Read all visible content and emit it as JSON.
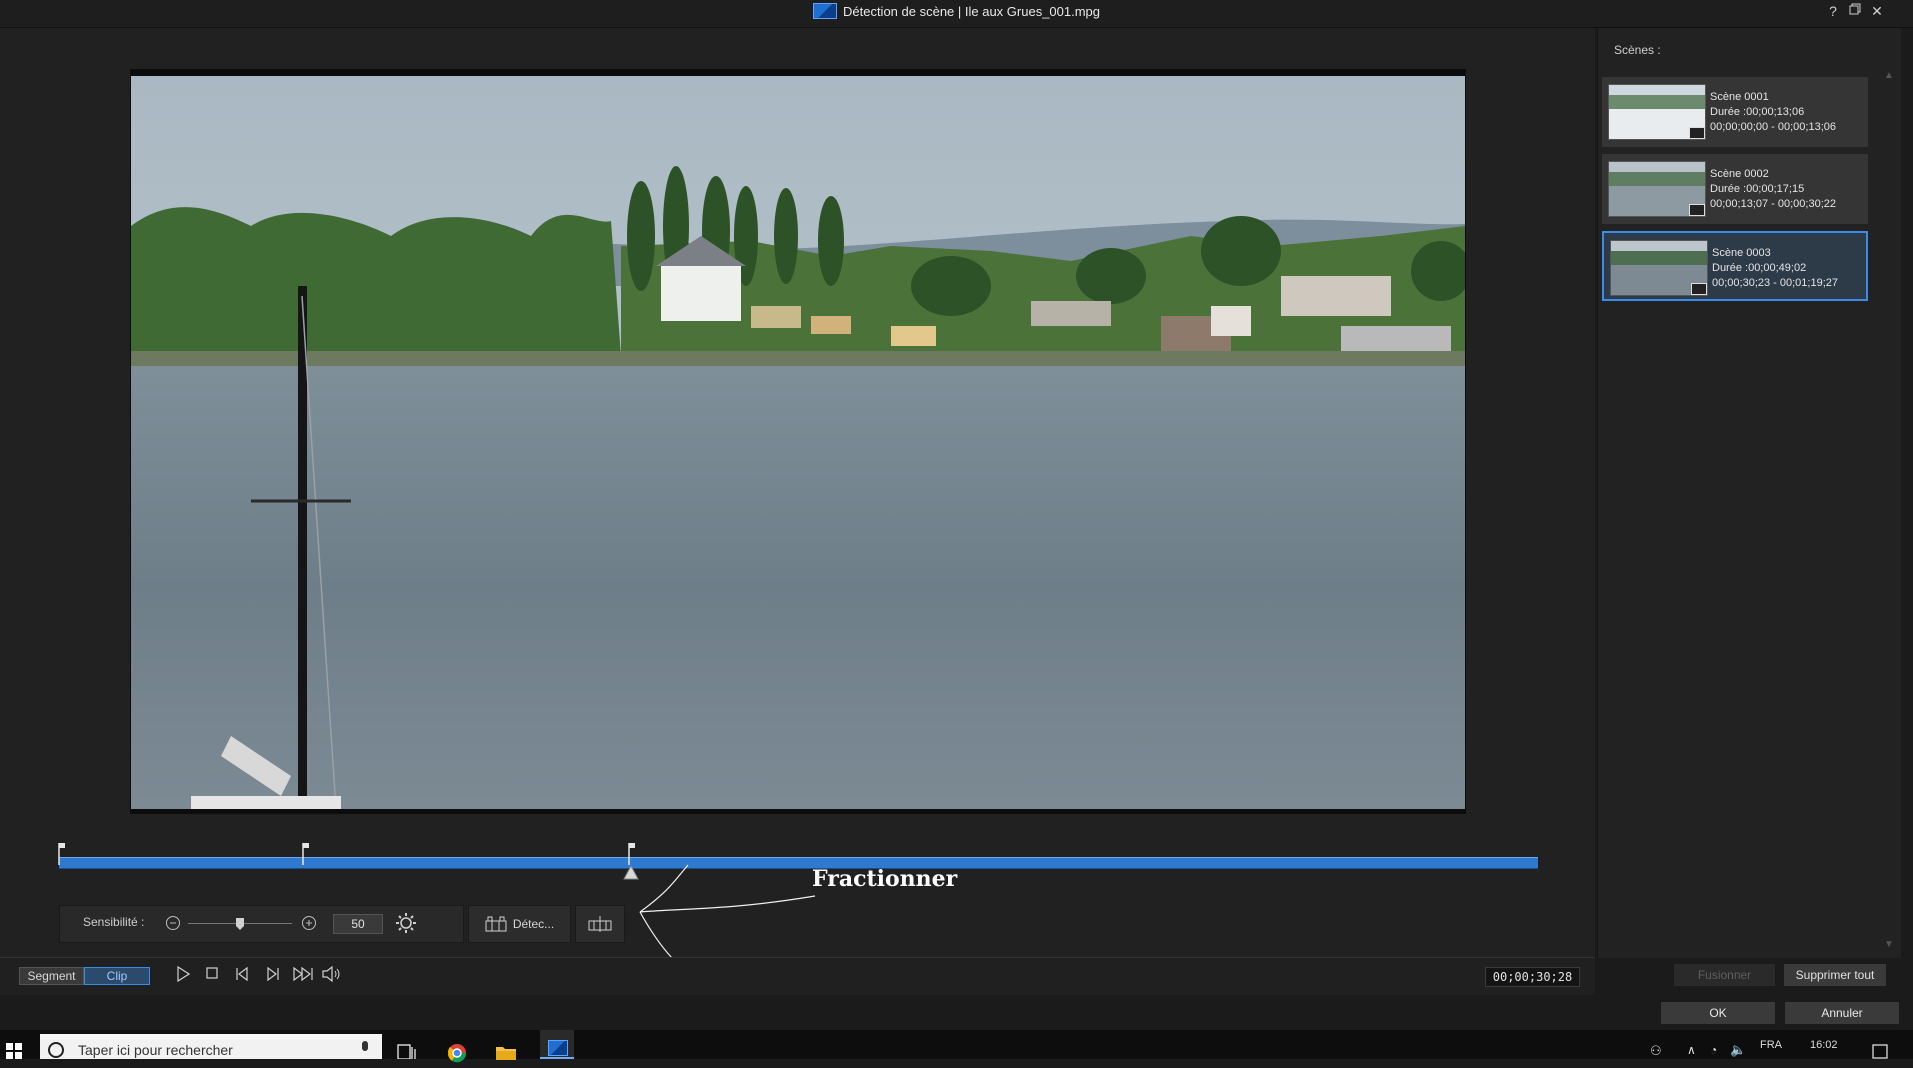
{
  "window": {
    "title": "Détection de scène | Ile aux Grues_001.mpg",
    "help_icon": "question-icon",
    "restore_icon": "restore-icon",
    "close_icon": "close-icon"
  },
  "timeline": {
    "split_markers": [
      "scene-marker",
      "scene-marker",
      "scene-marker"
    ],
    "annotation": "Fractionner",
    "accent_color": "#2f79d0"
  },
  "controls": {
    "sensitivity_label": "Sensibilité :",
    "sensitivity_value": "50",
    "sensitivity_level": 0.5,
    "detect_label": "Détec...",
    "minus_icon": "minus-circle-icon",
    "plus_icon": "plus-circle-icon",
    "settings_icon": "gear-icon",
    "split_icon": "split-icon"
  },
  "bottom_bar": {
    "segment_label": "Segment",
    "clip_label": "Clip",
    "timecode": "00;00;30;28"
  },
  "scenes_panel": {
    "header": "Scènes :",
    "scenes": [
      {
        "name": "Scène 0001",
        "duration": "Durée :00;00;13;06",
        "range": "00;00;00;00 - 00;00;13;06",
        "selected": false
      },
      {
        "name": "Scène 0002",
        "duration": "Durée :00;00;17;15",
        "range": "00;00;13;07 - 00;00;30;22",
        "selected": false
      },
      {
        "name": "Scène 0003",
        "duration": "Durée :00;00;49;02",
        "range": "00;00;30;23 - 00;01;19;27",
        "selected": true
      }
    ],
    "merge_label": "Fusionner",
    "delete_all_label": "Supprimer tout"
  },
  "footer": {
    "ok_label": "OK",
    "cancel_label": "Annuler"
  },
  "taskbar": {
    "search_placeholder": "Taper ici pour rechercher",
    "language": "FRA",
    "time": "16:02"
  }
}
